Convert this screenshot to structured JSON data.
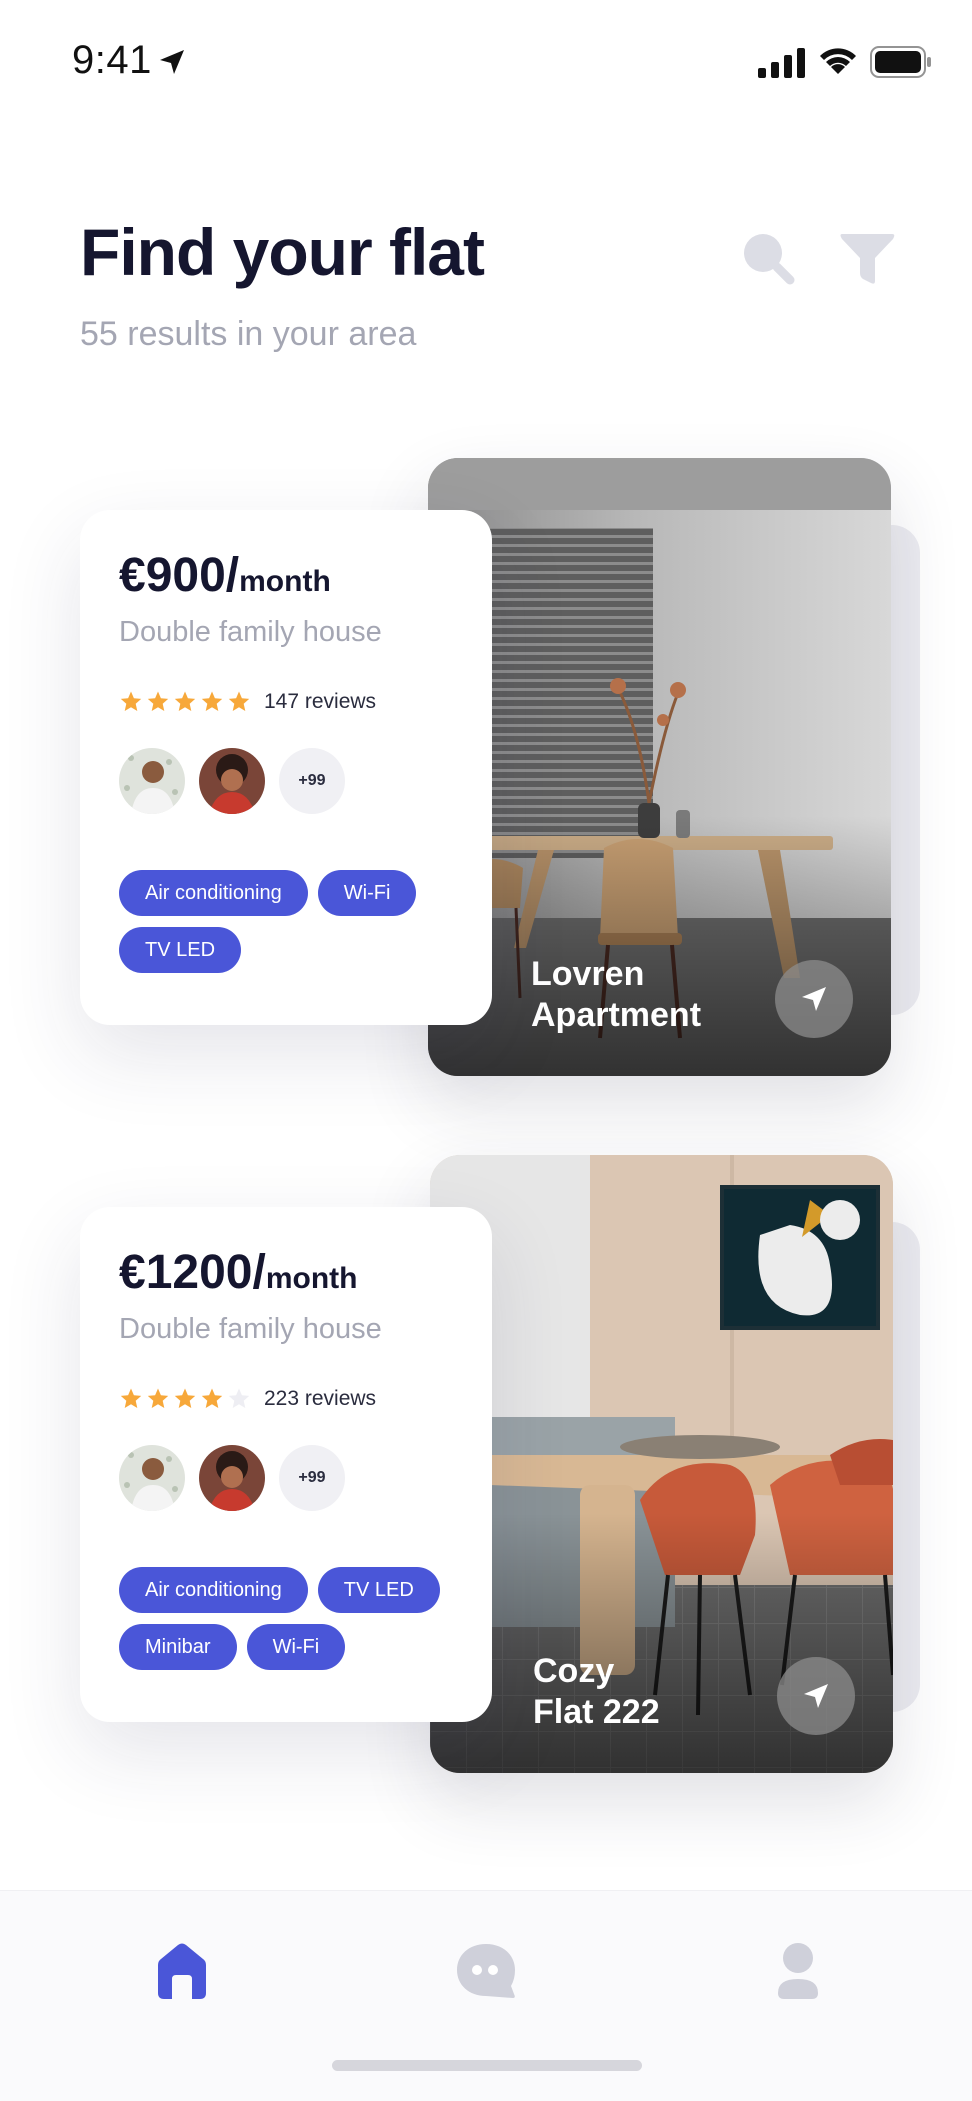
{
  "status_bar": {
    "time": "9:41"
  },
  "header": {
    "title": "Find your flat",
    "subtitle": "55 results in your area"
  },
  "listings": [
    {
      "price": "€900/",
      "unit": "month",
      "type": "Double family house",
      "rating": 5,
      "reviews": "147 reviews",
      "more_viewers": "+99",
      "amenities": [
        "Air conditioning",
        "Wi-Fi",
        "TV LED"
      ],
      "name_line1": "Lovren",
      "name_line2": "Apartment"
    },
    {
      "price": "€1200/",
      "unit": "month",
      "type": "Double family house",
      "rating": 4,
      "reviews": "223 reviews",
      "more_viewers": "+99",
      "amenities": [
        "Air conditioning",
        "TV LED",
        "Minibar",
        "Wi-Fi"
      ],
      "name_line1": "Cozy",
      "name_line2": "Flat 222"
    }
  ],
  "tab_bar": {
    "items": [
      "home-icon",
      "chat-icon",
      "profile-icon"
    ],
    "active": "home-icon"
  },
  "colors": {
    "accent": "#4a56d8",
    "star_filled": "#f7a83a",
    "star_empty": "#eeeef3",
    "title": "#15162f",
    "muted": "#a4a6b3",
    "tab_inactive": "#cfd0da"
  }
}
